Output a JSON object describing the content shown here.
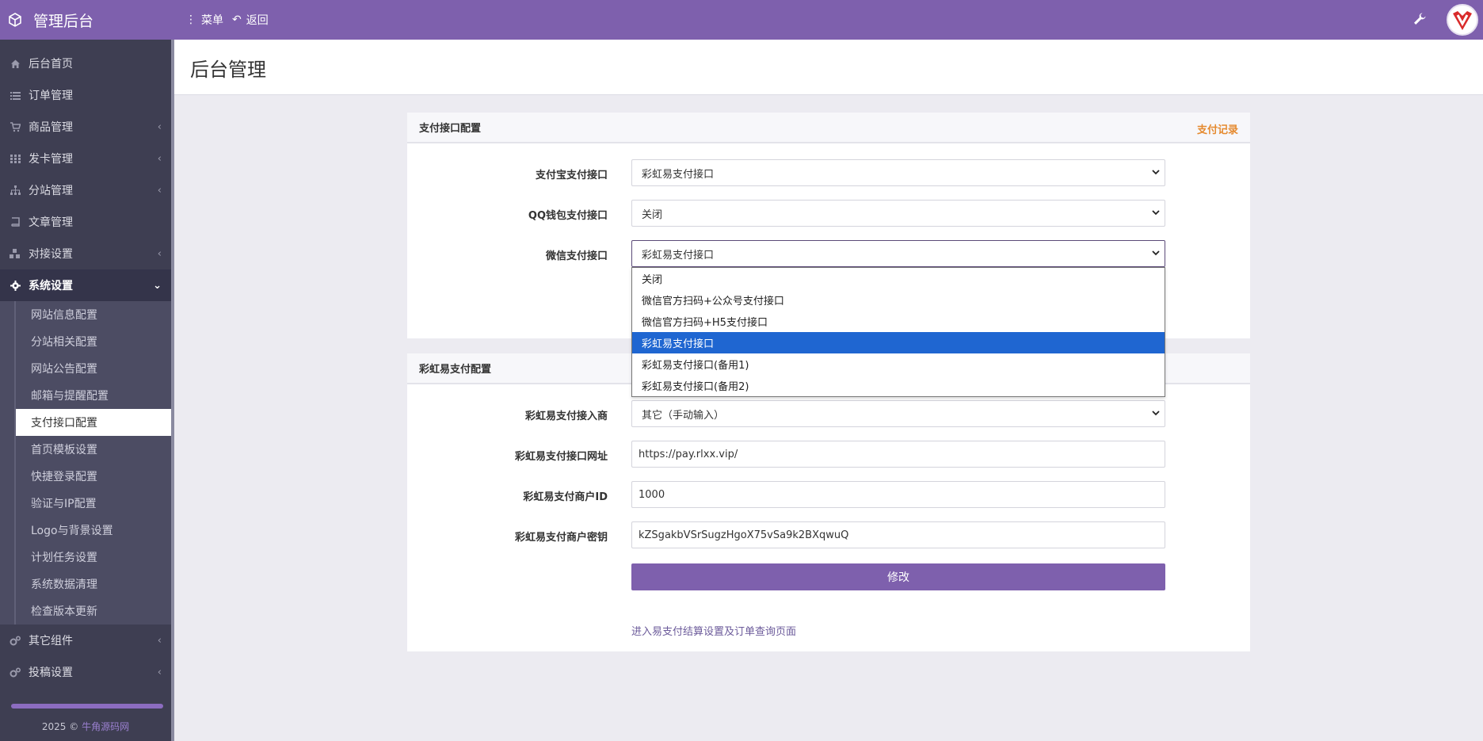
{
  "topbar": {
    "brand": "管理后台",
    "menu_label": "菜单",
    "back_label": "返回"
  },
  "sidebar": {
    "items": [
      {
        "label": "后台首页",
        "icon": "home-icon",
        "chevron": false
      },
      {
        "label": "订单管理",
        "icon": "list-icon",
        "chevron": false
      },
      {
        "label": "商品管理",
        "icon": "cart-icon",
        "chevron": true
      },
      {
        "label": "发卡管理",
        "icon": "grid-icon",
        "chevron": true
      },
      {
        "label": "分站管理",
        "icon": "sitemap-icon",
        "chevron": true
      },
      {
        "label": "文章管理",
        "icon": "book-icon",
        "chevron": false
      },
      {
        "label": "对接设置",
        "icon": "cubes-icon",
        "chevron": true
      },
      {
        "label": "系统设置",
        "icon": "gear-icon",
        "chevron": true
      }
    ],
    "sub_items": [
      "网站信息配置",
      "分站相关配置",
      "网站公告配置",
      "邮箱与提醒配置",
      "支付接口配置",
      "首页模板设置",
      "快捷登录配置",
      "验证与IP配置",
      "Logo与背景设置",
      "计划任务设置",
      "系统数据清理",
      "检查版本更新"
    ],
    "current_sub": "支付接口配置",
    "bottom_items": [
      {
        "label": "其它组件",
        "icon": "cogs-icon"
      },
      {
        "label": "投稿设置",
        "icon": "cogs-icon"
      }
    ],
    "footer_year": "2025 ©",
    "footer_link": "牛角源码网"
  },
  "page": {
    "title": "后台管理"
  },
  "pay_config": {
    "heading": "支付接口配置",
    "records_link": "支付记录",
    "alipay_label": "支付宝支付接口",
    "alipay_value": "彩虹易支付接口",
    "qq_label": "QQ钱包支付接口",
    "qq_value": "关闭",
    "wechat_label": "微信支付接口",
    "wechat_value": "彩虹易支付接口"
  },
  "wechat_dropdown": {
    "options": [
      "关闭",
      "微信官方扫码+公众号支付接口",
      "微信官方扫码+H5支付接口",
      "彩虹易支付接口",
      "彩虹易支付接口(备用1)",
      "彩虹易支付接口(备用2)"
    ],
    "selected_index": 3
  },
  "epay_config": {
    "heading": "彩虹易支付配置",
    "provider_label": "彩虹易支付接入商",
    "provider_value": "其它（手动输入）",
    "url_label": "彩虹易支付接口网址",
    "url_value": "https://pay.rlxx.vip/",
    "merchant_id_label": "彩虹易支付商户ID",
    "merchant_id_value": "1000",
    "merchant_key_label": "彩虹易支付商户密钥",
    "merchant_key_value": "kZSgakbVSrSugzHgoX75vSa9k2BXqwuQ",
    "submit_label": "修改",
    "settle_link": "进入易支付结算设置及订单查询页面"
  },
  "colors": {
    "topbar": "#7e60ad",
    "sidebar": "#3e3e52",
    "accent_orange": "#e58a2f",
    "dropdown_selected": "#1f66d1"
  }
}
